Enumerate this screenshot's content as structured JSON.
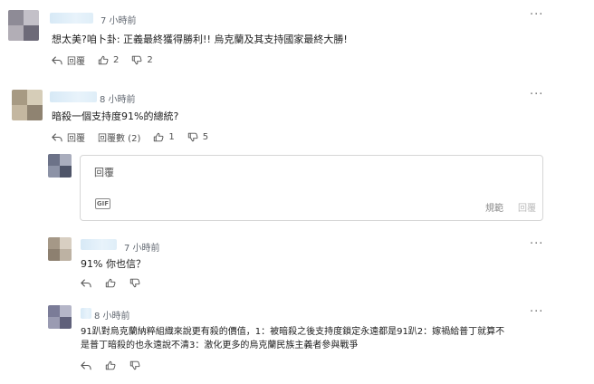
{
  "comments": [
    {
      "time": "7 小時前",
      "text": "想太美?咱卜卦: 正義最終獲得勝利!! 烏克蘭及其支持國家最終大勝!",
      "reply_label": "回覆",
      "likes": "2",
      "dislikes": "2"
    },
    {
      "time": "8 小時前",
      "text": "暗殺一個支持度91%的總統?",
      "reply_label": "回覆",
      "replies_label": "回覆數 (2)",
      "likes": "1",
      "dislikes": "5"
    }
  ],
  "reply_form": {
    "placeholder": "回覆",
    "gif_label": "GIF",
    "rules_label": "規範",
    "submit_label": "回覆"
  },
  "replies": [
    {
      "time": "7 小時前",
      "text": "91% 你也信？"
    },
    {
      "time": "8 小時前",
      "text_line1": "91趴對烏克蘭納粹組織來說更有殺的價值，1：被暗殺之後支持度鎖定永遠都是91趴2：嫁禍給普丁就算不",
      "text_line2": "是普丁暗殺的也永遠說不清3：激化更多的烏克蘭民族主義者參與戰爭"
    }
  ],
  "icons": {
    "reply": "reply-arrow-icon",
    "like": "thumb-up-icon",
    "dislike": "thumb-down-icon",
    "more": "more-dots-icon"
  },
  "colors": {
    "username_blur": "#d7e9f6",
    "text": "#1d1d1d",
    "muted": "#606770"
  }
}
